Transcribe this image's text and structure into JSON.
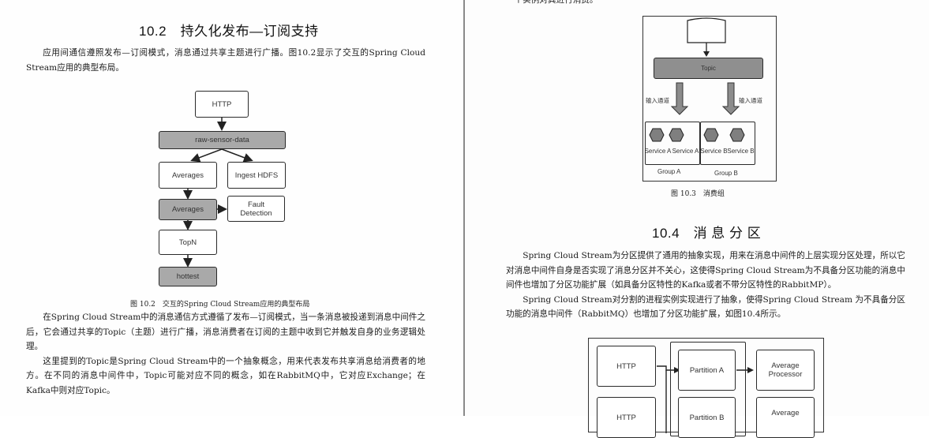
{
  "left_page": {
    "section_heading": "10.2　持久化发布—订阅支持",
    "intro_paragraph": "应用间通信遵照发布—订阅模式，消息通过共享主题进行广播。图10.2显示了交互的Spring Cloud Stream应用的典型布局。",
    "figure": {
      "caption": "图 10.2　交互的Spring Cloud Stream应用的典型布局",
      "nodes": {
        "http": "HTTP",
        "raw_sensor_data": "raw-sensor-data",
        "averages_1": "Averages",
        "ingest_hdfs": "Ingest HDFS",
        "averages_2": "Averages",
        "fault_detection": "Fault Detection",
        "topn": "TopN",
        "hottest": "hottest"
      }
    },
    "paragraphs": [
      "在Spring Cloud Stream中的消息通信方式遵循了发布—订阅模式，当一条消息被投递到消息中间件之后，它会通过共享的Topic（主题）进行广播，消息消费者在订阅的主题中收到它并触发自身的业务逻辑处理。",
      "这里提到的Topic是Spring Cloud Stream中的一个抽象概念，用来代表发布共享消息给消费者的地方。在不同的消息中间件中，Topic可能对应不同的概念，如在RabbitMQ中，它对应Exchange；在Kafka中则对应Topic。"
    ]
  },
  "right_page": {
    "top_text_fragment": "一个实例对其进行消费。",
    "figure_10_3": {
      "caption": "图 10.3　消费组",
      "topic_label": "Topic",
      "input_channel_left": "输入通道",
      "input_channel_right": "输入通道",
      "services": [
        "Service A",
        "Service A",
        "Service B",
        "Service B"
      ],
      "group_a": "Group A",
      "group_b": "Group B"
    },
    "section_heading": "10.4　消 息 分 区",
    "paragraphs": [
      "Spring Cloud Stream为分区提供了通用的抽象实现，用来在消息中间件的上层实现分区处理，所以它对消息中间件自身是否实现了消息分区并不关心，这使得Spring Cloud Stream为不具备分区功能的消息中间件也增加了分区功能扩展（如具备分区特性的Kafka或者不带分区特性的RabbitMP）。",
      "Spring Cloud Stream对分割的进程实例实现进行了抽象，使得Spring Cloud Stream 为不具备分区功能的消息中间件（RabbitMQ）也增加了分区功能扩展，如图10.4所示。"
    ],
    "figure_10_4": {
      "http_1": "HTTP",
      "http_2": "HTTP",
      "partition_a": "Partition A",
      "partition_b": "Partition B",
      "average_processor_1": "Average Processor",
      "average_processor_2": "Average"
    }
  }
}
